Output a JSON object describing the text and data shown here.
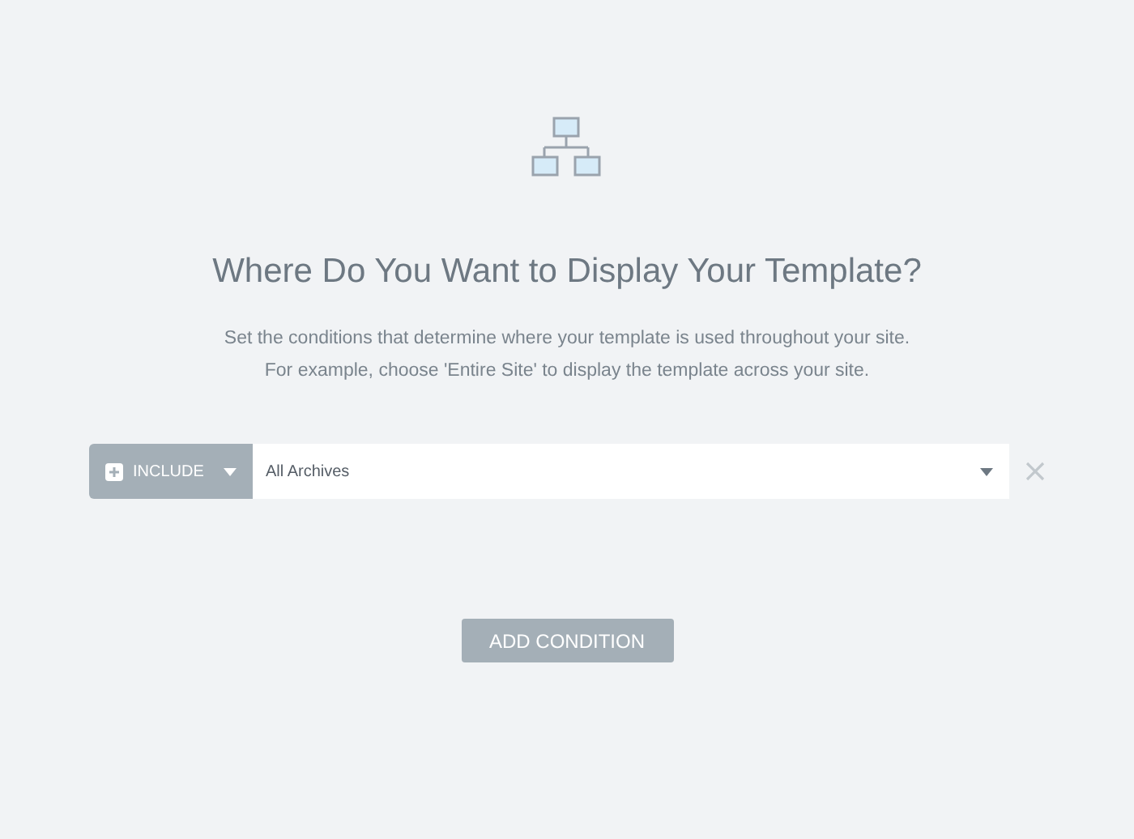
{
  "title": "Where Do You Want to Display Your Template?",
  "description": [
    "Set the conditions that determine where your template is used throughout your site.",
    "For example, choose 'Entire Site' to display the template across your site."
  ],
  "conditions": [
    {
      "type": "INCLUDE",
      "value": "All Archives"
    }
  ],
  "add_button": "ADD CONDITION"
}
